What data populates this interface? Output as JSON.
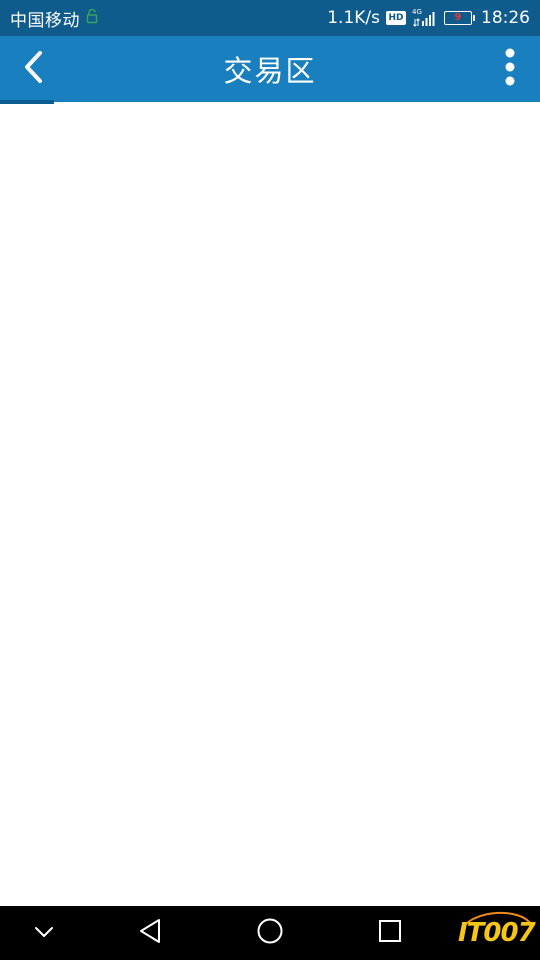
{
  "status_bar": {
    "carrier": "中国移动",
    "net_speed": "1.1K/s",
    "hd": "HD",
    "network_type": "4G",
    "battery_level": "9",
    "time": "18:26"
  },
  "app_bar": {
    "title": "交易区"
  },
  "nav_bar": {
    "watermark": "IT007"
  },
  "colors": {
    "status_bar": "#0f5c8c",
    "app_bar": "#1a7fbe",
    "battery_low": "#e23b3b",
    "watermark": "#f5c518"
  },
  "icons": {
    "back": "chevron-left-icon",
    "more": "more-vertical-icon",
    "nav_collapse": "chevron-down-icon",
    "nav_back": "triangle-back-icon",
    "nav_home": "circle-home-icon",
    "nav_recents": "square-recents-icon"
  }
}
